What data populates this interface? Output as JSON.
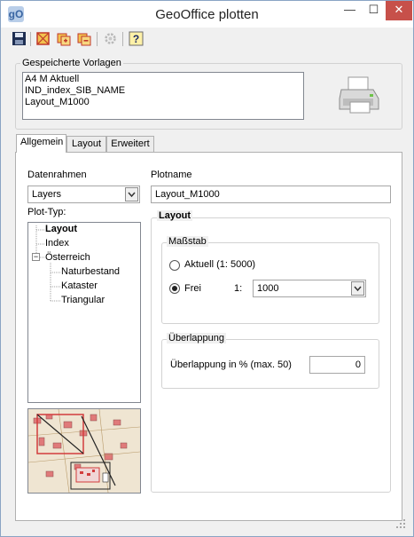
{
  "window": {
    "title": "GeoOffice plotten",
    "logo_text": "gO",
    "minimize_glyph": "—",
    "maximize_glyph": "☐",
    "close_glyph": "✕"
  },
  "toolbar": {
    "buttons": [
      "save-icon",
      "frame-icon",
      "stack-add-icon",
      "stack-remove-icon",
      "settings-icon",
      "help-icon"
    ]
  },
  "templates": {
    "title": "Gespeicherte Vorlagen",
    "items": [
      "A4 M Aktuell",
      "IND_index_SIB_NAME",
      "Layout_M1000"
    ]
  },
  "tabs": [
    {
      "label": "Allgemein",
      "active": true
    },
    {
      "label": "Layout",
      "active": false
    },
    {
      "label": "Erweitert",
      "active": false
    }
  ],
  "general": {
    "datenrahmen_label": "Datenrahmen",
    "datenrahmen_value": "Layers",
    "plottyp_label": "Plot-Typ:",
    "tree": [
      {
        "label": "Layout",
        "bold": true
      },
      {
        "label": "Index",
        "bold": false
      },
      {
        "label": "Österreich",
        "bold": false
      },
      {
        "label": "Naturbestand",
        "bold": false
      },
      {
        "label": "Kataster",
        "bold": false
      },
      {
        "label": "Triangular",
        "bold": false
      }
    ],
    "tree_expander": "−",
    "plotname_label": "Plotname",
    "plotname_value": "Layout_M1000"
  },
  "layout_group": {
    "title": "Layout",
    "massstab": {
      "title": "Maßstab",
      "option_current": "Aktuell (1: 5000)",
      "option_free": "Frei",
      "selected": "free",
      "ratio_label": "1:",
      "ratio_value": "1000"
    },
    "overlap": {
      "title": "Überlappung",
      "field_label": "Überlappung in % (max. 50)",
      "field_value": "0"
    }
  },
  "colors": {
    "close_button": "#c7504a",
    "window_border": "#8aa4c4",
    "map_red": "#d23c3c",
    "map_building": "#e07a7a"
  }
}
